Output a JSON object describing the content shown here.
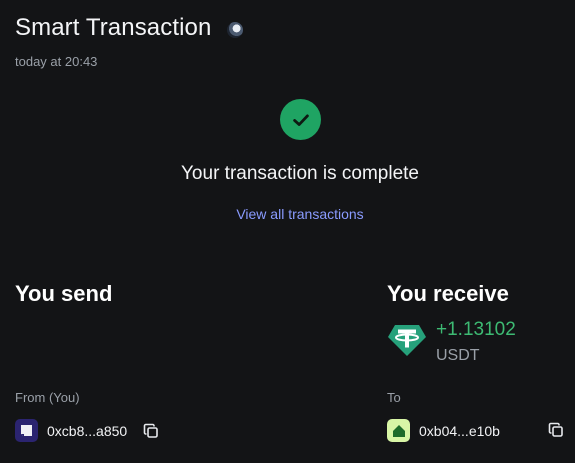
{
  "header": {
    "title": "Smart Transaction",
    "timestamp": "today at 20:43",
    "network_icon": "network-globe-icon"
  },
  "status": {
    "icon": "check-circle-icon",
    "message": "Your transaction is complete",
    "link_label": "View all transactions",
    "colors": {
      "success": "#1fa463",
      "link": "#8a9bff"
    }
  },
  "send": {
    "heading": "You send",
    "from_label": "From (You)",
    "from_address": "0xcb8...a850"
  },
  "receive": {
    "heading": "You receive",
    "token_icon": "tether-usdt-icon",
    "amount": "+1.13102",
    "symbol": "USDT",
    "to_label": "To",
    "to_address": "0xb04...e10b",
    "colors": {
      "amount": "#3dba73",
      "token": "#26a17b"
    }
  },
  "icons": {
    "copy": "copy-icon",
    "from_avatar": "account-avatar-icon",
    "to_avatar": "account-avatar-icon"
  }
}
